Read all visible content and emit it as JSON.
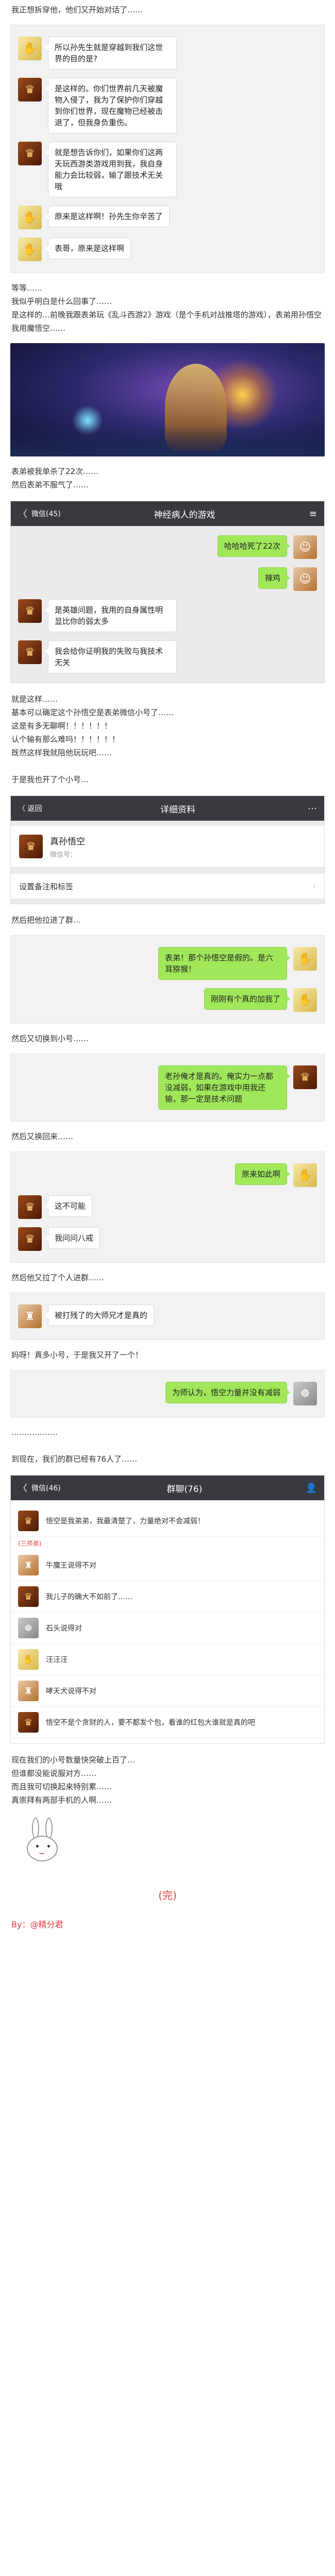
{
  "s1": [
    "我正想拆穿他，他们又开始对话了……"
  ],
  "chat1": [
    {
      "side": "left",
      "av": "a",
      "icon": "✋",
      "text": "所以孙先生就是穿越到我们这世界的目的是?"
    },
    {
      "side": "left",
      "av": "b",
      "icon": "♛",
      "text": "是这样的。你们世界前几天被魔物入侵了，我为了保护你们穿越到你们世界，现在魔物已经被击退了，但我身负重伤。"
    },
    {
      "side": "left",
      "av": "b",
      "icon": "♛",
      "text": "就是想告诉你们，如果你们这两天玩西游类游戏用到我，我自身能力会比较弱，输了跟技术无关哦"
    },
    {
      "side": "left",
      "av": "a",
      "icon": "✋",
      "text": "原来是这样啊！孙先生你辛苦了"
    },
    {
      "side": "left",
      "av": "a",
      "icon": "✋",
      "text": "表哥，原来是这样啊"
    }
  ],
  "s2": [
    "等等……",
    "我似乎明白是什么回事了……",
    "是这样的…前晚我跟表弟玩《乱斗西游2》游戏（是个手机对战推塔的游戏），表弟用孙悟空我用魔悟空……"
  ],
  "s3": [
    "表弟被我单杀了22次……",
    "然后表弟不服气了……"
  ],
  "phone1": {
    "back": "〈",
    "side": "微信(45)",
    "title": "神经病人的游戏",
    "menu": "≡"
  },
  "chat2": [
    {
      "side": "right",
      "av": "d",
      "icon": "☺",
      "text": "哈哈哈死了22次"
    },
    {
      "side": "right",
      "av": "d",
      "icon": "☺",
      "text": "辣鸡"
    },
    {
      "side": "left",
      "av": "b",
      "icon": "♛",
      "text": "是英雄问题，我用的自身属性明显比你的弱太多"
    },
    {
      "side": "left",
      "av": "b",
      "icon": "♛",
      "text": "我会给你证明我的失败与我技术无关"
    }
  ],
  "s4": [
    "就是这样……",
    "基本可以确定这个孙悟空是表弟微信小号了……",
    "这是有多无聊啊！！！！！！",
    "认个输有那么难吗！！！！！！",
    "既然这样我就陪他玩玩吧……",
    "",
    "于是我也开了个小号…"
  ],
  "phone2": {
    "back": "〈 返回",
    "title": "详细资料",
    "menu": "⋯",
    "name": "真孙悟空",
    "wxid": "微信号：",
    "row": "设置备注和标签",
    "chev": "›"
  },
  "s5": [
    "然后把他拉进了群…"
  ],
  "chat3": [
    {
      "side": "right",
      "av": "a",
      "icon": "✋",
      "text": "表弟！那个孙悟空是假的。是六耳猕猴！"
    },
    {
      "side": "right",
      "av": "a",
      "icon": "✋",
      "text": "刚刚有个真的加我了"
    }
  ],
  "s6": [
    "然后又切换到小号……"
  ],
  "chat4": [
    {
      "side": "right",
      "av": "b",
      "icon": "♛",
      "text": "老孙俺才是真的。俺实力一点都没减弱，如果在游戏中用我还输，那一定是技术问题"
    }
  ],
  "s7": [
    "然后又换回来……"
  ],
  "chat5": [
    {
      "side": "right",
      "av": "a",
      "icon": "✋",
      "text": "原来如此啊"
    },
    {
      "side": "left",
      "av": "b",
      "icon": "♛",
      "text": "这不可能"
    },
    {
      "side": "left",
      "av": "b",
      "icon": "♛",
      "text": "我问问八戒"
    }
  ],
  "s8": [
    "然后他又拉了个人进群……"
  ],
  "chat6": [
    {
      "side": "left",
      "av": "d",
      "icon": "♜",
      "text": "被打残了的大师兄才是真的"
    }
  ],
  "s9": [
    "妈呀！真多小号，于是我又开了一个！"
  ],
  "chat7": [
    {
      "side": "right",
      "av": "c",
      "icon": "☸",
      "text": "为师认为，悟空力量并没有减弱"
    }
  ],
  "s10": [
    "………………",
    "",
    "到现在，我们的群已经有76人了……"
  ],
  "phone3": {
    "back": "〈",
    "side": "微信(46)",
    "title": "群聊(76)",
    "menu": "👤"
  },
  "group": [
    {
      "av": "b",
      "icon": "♛",
      "tag": "",
      "text": "悟空是我弟弟，我最清楚了，力量绝对不会减弱！"
    },
    {
      "av": "d",
      "icon": "♜",
      "tag": "(三师弟)",
      "text": "牛魔王说得不对"
    },
    {
      "av": "b",
      "icon": "♛",
      "tag": "",
      "text": "我儿子的确大不如前了……"
    },
    {
      "av": "c",
      "icon": "☸",
      "tag": "",
      "text": "石头说得对"
    },
    {
      "av": "a",
      "icon": "✋",
      "tag": "",
      "text": "汪汪汪"
    },
    {
      "av": "d",
      "icon": "♜",
      "tag": "",
      "text": "哮天犬说得不对"
    },
    {
      "av": "b",
      "icon": "♛",
      "tag": "",
      "text": "悟空不是个贪财的人，要不都发个包，看谁的红包大谁就是真的吧"
    }
  ],
  "s11": [
    "现在我们的小号数量快突破上百了…",
    "但谁都没能说服对方……",
    "而且我可切换起来特别累……",
    "真崇拜有两部手机的人啊……"
  ],
  "end": "(完)",
  "byline": "By：@精分君"
}
